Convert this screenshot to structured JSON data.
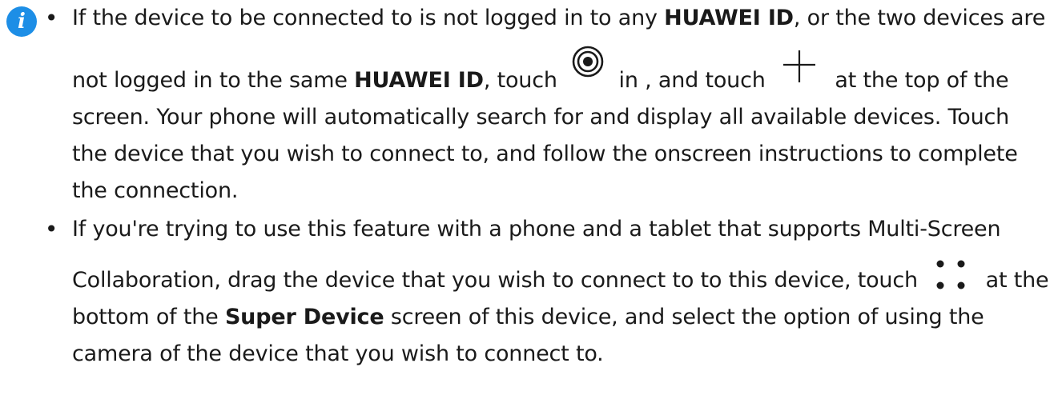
{
  "icons": {
    "info": "info-icon",
    "info_glyph": "i",
    "info_color": "#1d8ee6",
    "target": "target-icon",
    "add": "add-icon",
    "more": "four-dots-icon"
  },
  "bullet": "•",
  "notes": [
    {
      "t1": "If the device to be connected to is not logged in to any ",
      "b1": "HUAWEI ID",
      "t2": ", or the two devices are not logged in to the same ",
      "b2": "HUAWEI ID",
      "t3": ", touch ",
      "t4": " in , and touch ",
      "t5": " at the top of the screen. Your phone will automatically search for and display all available devices. Touch the device that you wish to connect to, and follow the onscreen instructions to complete the connection."
    },
    {
      "t1": "If you're trying to use this feature with a phone and a tablet that supports Multi-Screen Collaboration, drag the device that you wish to connect to to this device, touch ",
      "t2": " at the bottom of the ",
      "b1": "Super Device",
      "t3": " screen of this device, and select the option of using the camera of the device that you wish to connect to."
    }
  ]
}
